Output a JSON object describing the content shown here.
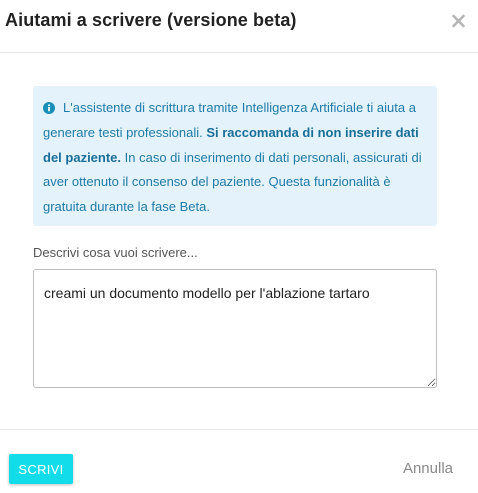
{
  "dialog": {
    "title": "Aiutami a scrivere (versione beta)",
    "close_icon": "close-icon"
  },
  "info": {
    "icon": "info-circle-icon",
    "text_1": "L'assistente di scrittura tramite Intelligenza Artificiale ti aiuta a generare testi professionali. ",
    "text_bold": "Si raccomanda di non inserire dati del paziente.",
    "text_2": " In caso di inserimento di dati personali, assicurati di aver ottenuto il consenso del paziente. Questa funzionalità è gratuita durante la fase Beta.",
    "background_color": "#e3f2fb",
    "text_color": "#1f7ba8"
  },
  "form": {
    "label": "Descrivi cosa vuoi scrivere...",
    "value": "creami un documento modello per l'ablazione tartaro"
  },
  "footer": {
    "submit_label": "SCRIVI",
    "cancel_label": "Annulla",
    "submit_color": "#12dcea"
  }
}
